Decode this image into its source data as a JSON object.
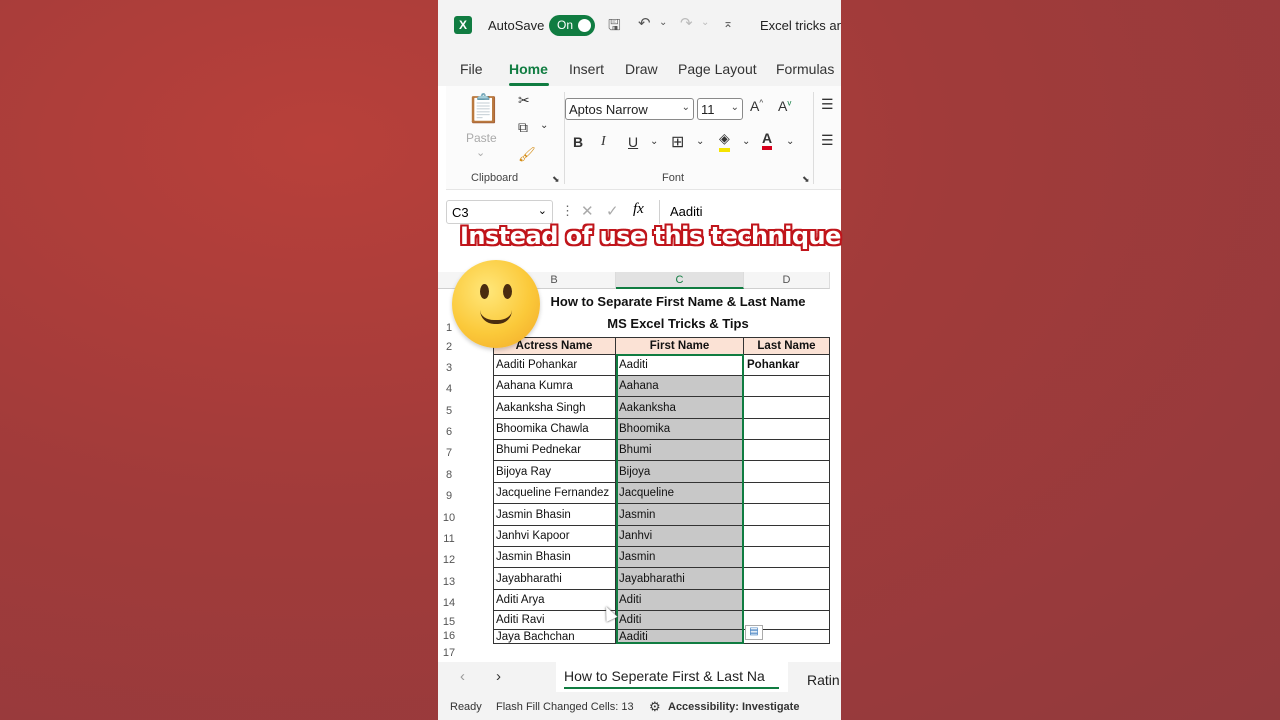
{
  "titlebar": {
    "autosave_label": "AutoSave",
    "autosave_state": "On",
    "doc_title": "Excel tricks and"
  },
  "tabs": [
    "File",
    "Home",
    "Insert",
    "Draw",
    "Page Layout",
    "Formulas"
  ],
  "active_tab": "Home",
  "ribbon": {
    "paste_label": "Paste",
    "clipboard_label": "Clipboard",
    "font_name": "Aptos Narrow",
    "font_size": "11",
    "font_label": "Font",
    "bold": "B",
    "italic": "I",
    "underline": "U"
  },
  "formula_bar": {
    "name_box": "C3",
    "fx": "fx",
    "value": "Aaditi"
  },
  "overlay_caption": "Instead of use this technique",
  "columns": [
    "B",
    "C",
    "D"
  ],
  "sheet": {
    "title": "How to Separate First Name & Last Name",
    "subtitle": "MS Excel Tricks & Tips",
    "headers": [
      "Actress Name",
      "First Name",
      "Last Name"
    ],
    "rows": [
      [
        "Aaditi Pohankar",
        "Aaditi",
        "Pohankar"
      ],
      [
        "Aahana Kumra",
        "Aahana",
        ""
      ],
      [
        "Aakanksha Singh",
        "Aakanksha",
        ""
      ],
      [
        "Bhoomika Chawla",
        "Bhoomika",
        ""
      ],
      [
        "Bhumi Pednekar",
        "Bhumi",
        ""
      ],
      [
        "Bijoya Ray",
        "Bijoya",
        ""
      ],
      [
        "Jacqueline Fernandez",
        "Jacqueline",
        ""
      ],
      [
        "Jasmin Bhasin",
        "Jasmin",
        ""
      ],
      [
        "Janhvi Kapoor",
        "Janhvi",
        ""
      ],
      [
        "Jasmin Bhasin",
        "Jasmin",
        ""
      ],
      [
        "Jayabharathi",
        "Jayabharathi",
        ""
      ],
      [
        "Aditi Arya",
        "Aditi",
        ""
      ],
      [
        "Aditi Ravi",
        "Aditi",
        ""
      ],
      [
        "Jaya Bachchan",
        "Aaditi",
        ""
      ]
    ],
    "row_numbers": [
      "1",
      "2",
      "3",
      "4",
      "5",
      "6",
      "7",
      "8",
      "9",
      "10",
      "11",
      "12",
      "13",
      "14",
      "15",
      "16",
      "17"
    ]
  },
  "sheet_tabs": {
    "active": "How to Seperate First & Last Na",
    "next": "Ratin"
  },
  "status_bar": {
    "ready": "Ready",
    "flash_fill": "Flash Fill Changed Cells: 13",
    "accessibility": "Accessibility: Investigate"
  },
  "colors": {
    "excel_green": "#107c41",
    "header_fill": "#fbe2d5",
    "flash_fill": "#c8c8c8",
    "background": "#a13b3a"
  }
}
